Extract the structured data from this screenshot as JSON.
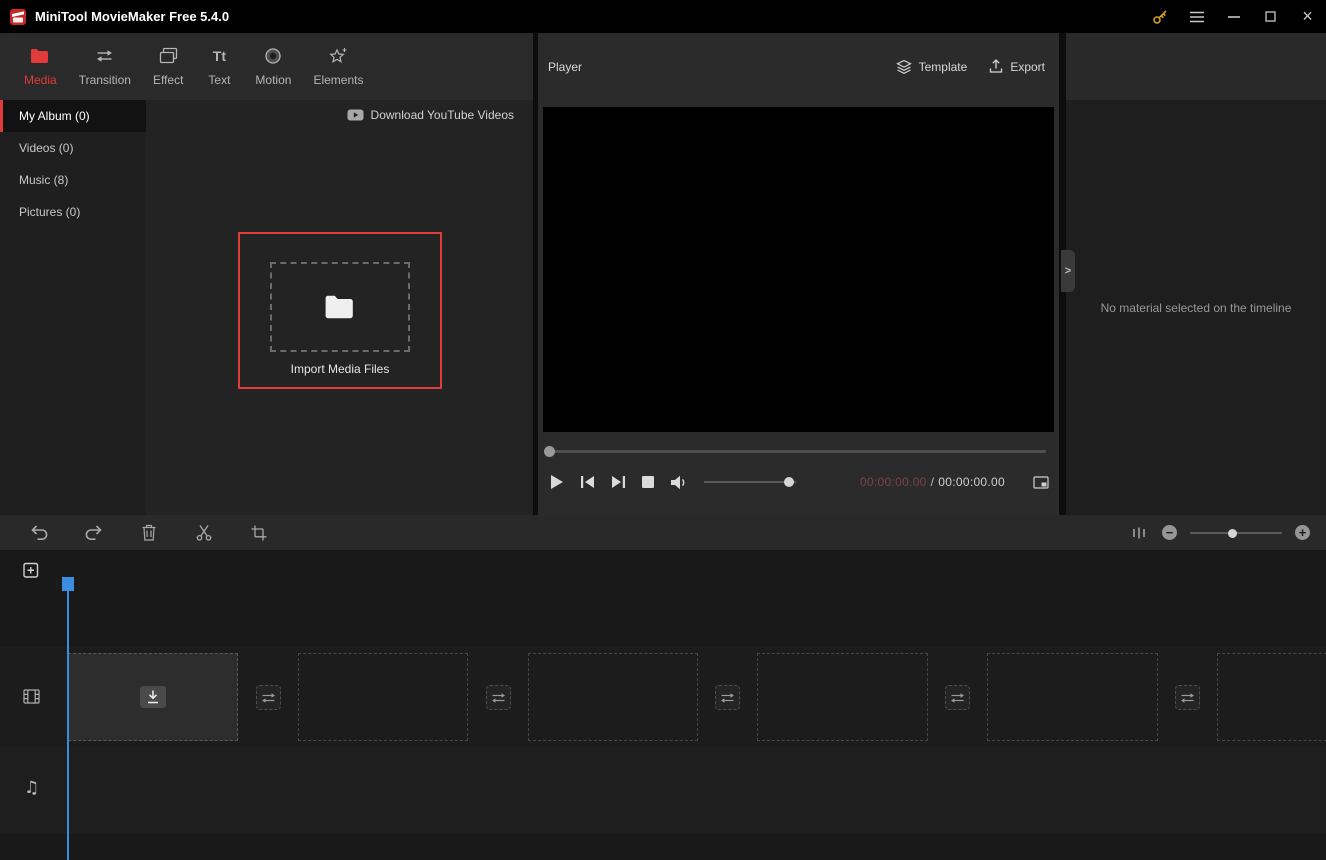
{
  "titlebar": {
    "app_title": "MiniTool MovieMaker Free 5.4.0"
  },
  "tabs": [
    {
      "label": "Media",
      "active": true
    },
    {
      "label": "Transition",
      "active": false
    },
    {
      "label": "Effect",
      "active": false
    },
    {
      "label": "Text",
      "active": false
    },
    {
      "label": "Motion",
      "active": false
    },
    {
      "label": "Elements",
      "active": false
    }
  ],
  "library": {
    "albums": [
      {
        "label": "My Album (0)",
        "active": true
      },
      {
        "label": "Videos (0)",
        "active": false
      },
      {
        "label": "Music (8)",
        "active": false
      },
      {
        "label": "Pictures (0)",
        "active": false
      }
    ],
    "download_youtube_label": "Download YouTube Videos",
    "import_label": "Import Media Files"
  },
  "player": {
    "title": "Player",
    "template_label": "Template",
    "export_label": "Export",
    "current_time": "00:00:00.00",
    "time_separator": "/",
    "total_time": "00:00:00.00"
  },
  "inspector": {
    "empty_message": "No material selected on the timeline"
  },
  "glyphs": {
    "close": "×",
    "music_note": "♫",
    "expander_chevron": ">",
    "text_tab": "Tt",
    "minus": "−",
    "plus": "+"
  },
  "colors": {
    "accent": "#e23b3b",
    "playhead": "#3c8de0",
    "key_gold": "#d8a21a",
    "time_current": "#7d4343"
  }
}
